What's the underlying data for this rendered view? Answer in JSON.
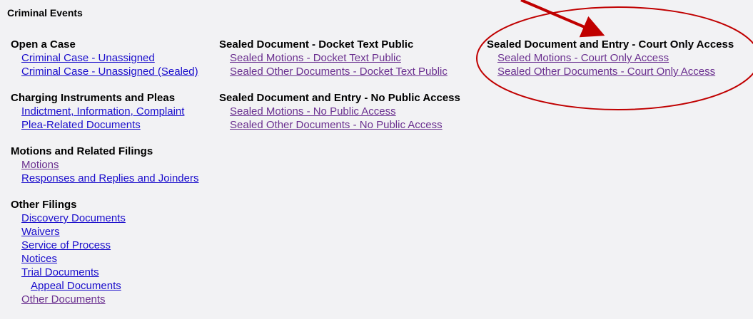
{
  "page": {
    "title": "Criminal Events"
  },
  "columns": [
    {
      "sections": [
        {
          "heading": "Open a Case",
          "links": [
            {
              "label": "Criminal Case - Unassigned",
              "visited": false
            },
            {
              "label": "Criminal Case - Unassigned (Sealed)",
              "visited": false
            }
          ]
        },
        {
          "heading": "Charging Instruments and Pleas",
          "links": [
            {
              "label": "Indictment, Information, Complaint",
              "visited": false
            },
            {
              "label": "Plea-Related Documents",
              "visited": false
            }
          ]
        },
        {
          "heading": "Motions and Related Filings",
          "links": [
            {
              "label": "Motions",
              "visited": true
            },
            {
              "label": "Responses and Replies and Joinders",
              "visited": false
            }
          ]
        },
        {
          "heading": "Other Filings",
          "links": [
            {
              "label": "Discovery Documents",
              "visited": false
            },
            {
              "label": "Waivers",
              "visited": false
            },
            {
              "label": "Service of Process",
              "visited": false
            },
            {
              "label": "Notices",
              "visited": false
            },
            {
              "label": "Trial Documents",
              "visited": false
            },
            {
              "label": "Appeal Documents",
              "visited": false
            },
            {
              "label": "Other Documents",
              "visited": true
            }
          ]
        }
      ]
    },
    {
      "sections": [
        {
          "heading": "Sealed Document - Docket Text Public",
          "links": [
            {
              "label": "Sealed Motions - Docket Text Public",
              "visited": true
            },
            {
              "label": "Sealed Other Documents - Docket Text Public",
              "visited": true
            }
          ]
        },
        {
          "heading": "Sealed Document and Entry - No Public Access",
          "links": [
            {
              "label": "Sealed Motions - No Public Access",
              "visited": true
            },
            {
              "label": "Sealed Other Documents - No Public Access",
              "visited": true
            }
          ]
        }
      ]
    },
    {
      "sections": [
        {
          "heading": "Sealed Document and Entry - Court Only Access",
          "links": [
            {
              "label": "Sealed Motions - Court Only Access",
              "visited": true
            },
            {
              "label": "Sealed Other Documents - Court Only Access",
              "visited": true
            }
          ]
        }
      ]
    }
  ],
  "annotation": {
    "color": "#c00000"
  }
}
